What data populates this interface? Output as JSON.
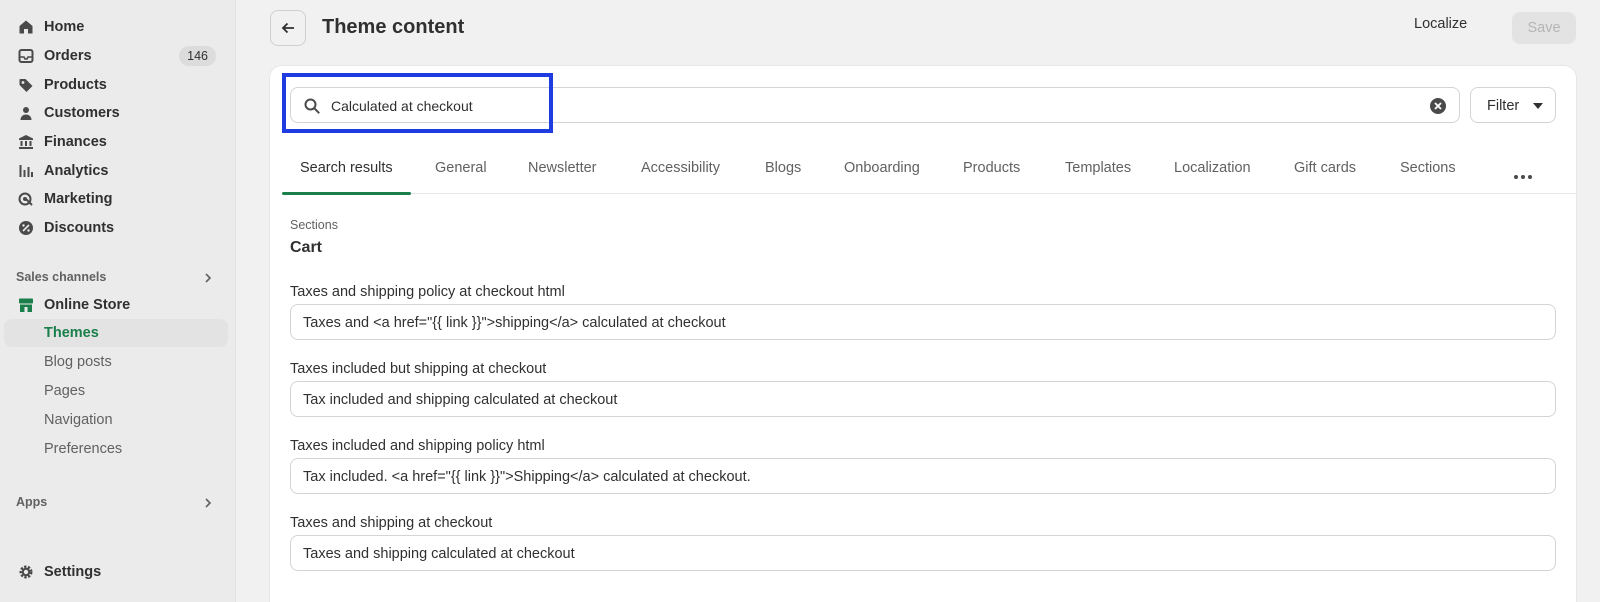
{
  "sidebar": {
    "items": [
      {
        "label": "Home",
        "icon": "home-icon"
      },
      {
        "label": "Orders",
        "icon": "orders-icon",
        "badge": "146"
      },
      {
        "label": "Products",
        "icon": "tag-icon"
      },
      {
        "label": "Customers",
        "icon": "person-icon"
      },
      {
        "label": "Finances",
        "icon": "bank-icon"
      },
      {
        "label": "Analytics",
        "icon": "bar-chart-icon"
      },
      {
        "label": "Marketing",
        "icon": "target-icon"
      },
      {
        "label": "Discounts",
        "icon": "discount-icon"
      }
    ],
    "sales_channels_label": "Sales channels",
    "online_store": {
      "label": "Online Store",
      "icon": "store-icon"
    },
    "online_store_sub": [
      "Themes",
      "Blog posts",
      "Pages",
      "Navigation",
      "Preferences"
    ],
    "apps_label": "Apps",
    "settings": {
      "label": "Settings",
      "icon": "gear-icon"
    }
  },
  "header": {
    "title": "Theme content",
    "localize_label": "Localize",
    "save_label": "Save"
  },
  "search": {
    "value": "Calculated at checkout",
    "filter_label": "Filter"
  },
  "tabs": [
    "Search results",
    "General",
    "Newsletter",
    "Accessibility",
    "Blogs",
    "Onboarding",
    "Products",
    "Templates",
    "Localization",
    "Gift cards",
    "Sections"
  ],
  "content": {
    "kicker": "Sections",
    "title": "Cart",
    "fields": [
      {
        "label": "Taxes and shipping policy at checkout html",
        "value": "Taxes and <a href=\"{{ link }}\">shipping</a> calculated at checkout"
      },
      {
        "label": "Taxes included but shipping at checkout",
        "value": "Tax included and shipping calculated at checkout"
      },
      {
        "label": "Taxes included and shipping policy html",
        "value": "Tax included. <a href=\"{{ link }}\">Shipping</a> calculated at checkout."
      },
      {
        "label": "Taxes and shipping at checkout",
        "value": "Taxes and shipping calculated at checkout"
      }
    ]
  },
  "colors": {
    "accent": "#1a7f4b",
    "highlight": "#1f3ce0"
  }
}
